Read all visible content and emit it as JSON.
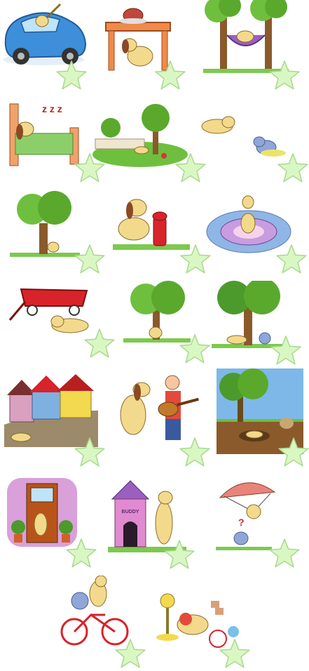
{
  "game": {
    "title": "",
    "star_fill": "#d9f7c3",
    "star_stroke": "#a9d98e",
    "cards": [
      {
        "id": "dog-driving-car",
        "star_icon": "star-icon"
      },
      {
        "id": "dog-under-table",
        "star_icon": "star-icon"
      },
      {
        "id": "dog-in-hammock",
        "star_icon": "star-icon"
      },
      {
        "id": "dog-sleeping-bed",
        "star_icon": "star-icon"
      },
      {
        "id": "dog-in-park",
        "star_icon": "star-icon"
      },
      {
        "id": "dog-chasing-cat",
        "star_icon": "star-icon"
      },
      {
        "id": "dog-behind-tree",
        "star_icon": "star-icon"
      },
      {
        "id": "dog-by-hydrant",
        "star_icon": "star-icon"
      },
      {
        "id": "dog-on-rug",
        "star_icon": "star-icon"
      },
      {
        "id": "dog-by-wagon",
        "star_icon": "star-icon"
      },
      {
        "id": "dog-under-tree",
        "star_icon": "star-icon"
      },
      {
        "id": "dog-and-cat-under-tree",
        "star_icon": "star-icon"
      },
      {
        "id": "dog-by-houses",
        "star_icon": "star-icon"
      },
      {
        "id": "dog-with-guitarist",
        "star_icon": "star-icon"
      },
      {
        "id": "dog-underground",
        "star_icon": "star-icon"
      },
      {
        "id": "dog-at-door",
        "star_icon": "star-icon"
      },
      {
        "id": "dog-by-doghouse",
        "star_icon": "star-icon"
      },
      {
        "id": "dog-parachuting",
        "star_icon": "star-icon"
      },
      {
        "id": "dog-and-cat-on-bike",
        "star_icon": "star-icon"
      },
      {
        "id": "dog-with-toys",
        "star_icon": "star-icon"
      }
    ],
    "doghouse_sign": "BUDDY",
    "question_mark": "?",
    "snore_text": "z z z"
  }
}
